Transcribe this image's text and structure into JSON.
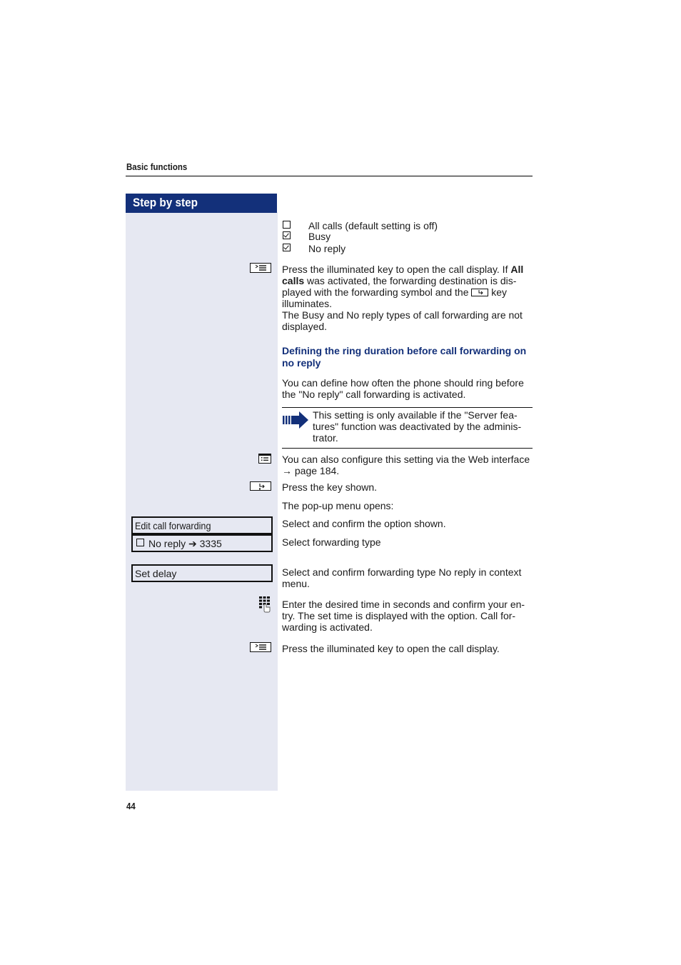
{
  "header": {
    "section": "Basic functions",
    "sidebar_title": "Step by step"
  },
  "checkboxes": [
    {
      "label": "All calls (default setting is off)",
      "checked": false
    },
    {
      "label": "Busy",
      "checked": true
    },
    {
      "label": "No reply",
      "checked": true
    }
  ],
  "steps": {
    "call_display_1": {
      "icon": "call-display-key-icon",
      "p1_before": "Press the illuminated key to open the call display. If ",
      "p1_bold1": "All",
      "p1_bold2": "calls",
      "p1_mid": " was activated, the forwarding destination is dis-",
      "p1_line3_a": "played with the forwarding symbol and the ",
      "p1_line3_b": " key",
      "p1_line4": "illuminates.",
      "p2_line1": "The Busy and No reply types of call forwarding are not",
      "p2_line2": "displayed."
    },
    "subheading_line1": "Defining the ring duration before call forwarding on",
    "subheading_line2": "no reply",
    "intro_line1": "You can define how often the phone should ring before",
    "intro_line2": "the \"No reply\" call forwarding is activated.",
    "note": {
      "icon": "note-arrow-icon",
      "line1": "This setting is only available if the \"Server fea-",
      "line2": "tures\" function was deactivated by the adminis-",
      "line3": "trator."
    },
    "web_interface": {
      "icon": "web-interface-icon",
      "line1": "You can also configure this setting via the Web interface",
      "line2": "→ page 184."
    },
    "forward_key": {
      "icon": "forwarding-key-icon",
      "text": "Press the key shown."
    },
    "popup_text": "The pop-up menu opens:",
    "edit_forwarding": {
      "menu_label": "Edit call forwarding",
      "text": "Select and confirm the option shown."
    },
    "forward_type": {
      "menu_label": "No reply ➔ 3335",
      "text": "Select forwarding type"
    },
    "set_delay": {
      "menu_label": "Set delay",
      "line1": "Select and confirm forwarding type No reply in context",
      "line2": "menu."
    },
    "enter_time": {
      "icon": "keypad-icon",
      "line1": "Enter the desired time in seconds and confirm your en-",
      "line2": "try. The set time is displayed with the option. Call for-",
      "line3": "warding is activated."
    },
    "call_display_2": {
      "icon": "call-display-key-icon",
      "text": "Press the illuminated key to open the call display."
    }
  },
  "footer": {
    "page_number": "44"
  }
}
